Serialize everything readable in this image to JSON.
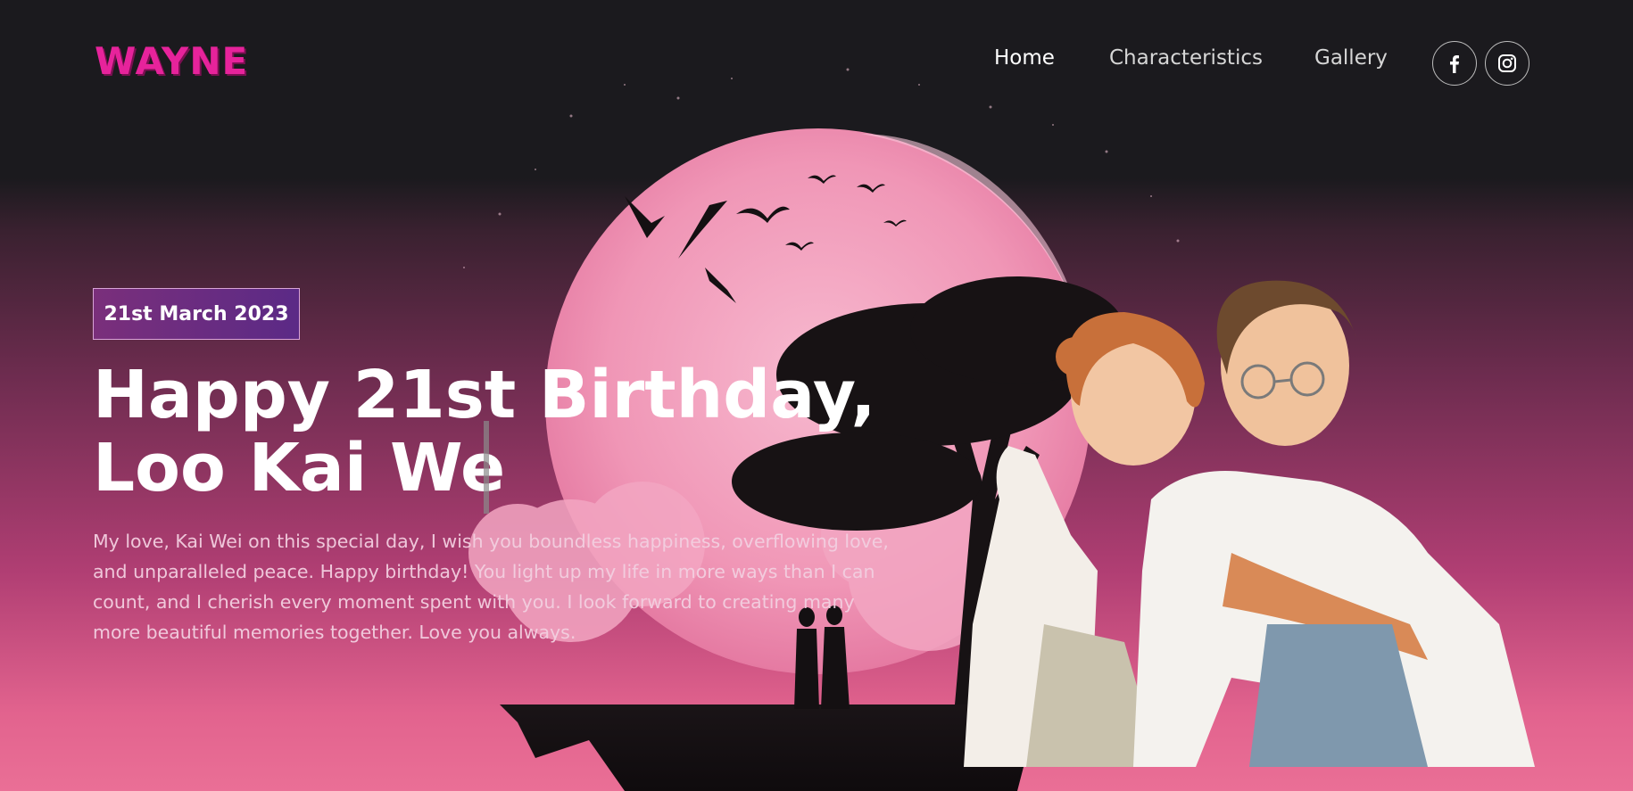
{
  "header": {
    "logo": "WAYNE",
    "nav": [
      {
        "label": "Home",
        "active": true
      },
      {
        "label": "Characteristics",
        "active": false
      },
      {
        "label": "Gallery",
        "active": false
      }
    ],
    "social": [
      {
        "icon": "facebook-icon"
      },
      {
        "icon": "instagram-icon"
      }
    ]
  },
  "hero": {
    "date": "21st March 2023",
    "title_line1": "Happy 21st Birthday,",
    "title_line2": "Loo Kai We",
    "message": "My love, Kai Wei on this special day, I wish you boundless happiness, overflowing love, and unparalleled peace. Happy birthday! You light up my life in more ways than I can count, and I cherish every moment spent with you. I look forward to creating many more beautiful memories together. Love you always."
  },
  "colors": {
    "accent": "#e6239b",
    "badge": "#5b2a86",
    "background_dark": "#1b1a1e",
    "background_pink": "#ea6f96"
  }
}
